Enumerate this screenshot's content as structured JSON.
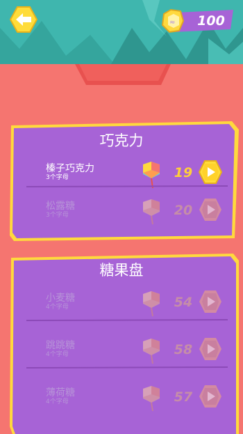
{
  "header": {
    "back_icon": "back-arrow-icon",
    "coin_icon": "coin-icon",
    "coins": "100"
  },
  "colors": {
    "background": "#f57570",
    "panel": "#a763d6",
    "panel_border": "#ffd93d",
    "teal": "#3fb6ae",
    "unlocked_number": "#ffcf3b",
    "locked_number": "#c68da8"
  },
  "sections": [
    {
      "title": "巧克力",
      "levels": [
        {
          "name": "榛子巧克力",
          "sub": "3个字母",
          "number": "19",
          "state": "unlocked"
        },
        {
          "name": "松露糖",
          "sub": "3个字母",
          "number": "20",
          "state": "locked"
        }
      ]
    },
    {
      "title": "糖果盘",
      "levels": [
        {
          "name": "小麦糖",
          "sub": "4个字母",
          "number": "54",
          "state": "locked"
        },
        {
          "name": "跳跳糖",
          "sub": "4个字母",
          "number": "58",
          "state": "locked"
        },
        {
          "name": "薄荷糖",
          "sub": "4个字母",
          "number": "57",
          "state": "locked"
        }
      ]
    }
  ]
}
